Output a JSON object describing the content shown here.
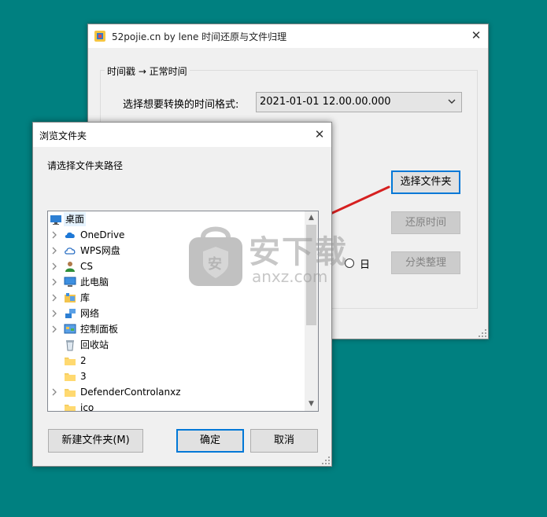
{
  "main_window": {
    "title": "52pojie.cn by lene 时间还原与文件归理",
    "close_glyph": "✕",
    "group_legend": "时间戳 → 正常时间",
    "format_label": "选择想要转换的时间格式:",
    "format_selected": "2021-01-01 12.00.00.000",
    "select_folder_button": "选择文件夹",
    "restore_time_button": "还原时间",
    "radio_day_label": "日",
    "classify_button": "分类整理"
  },
  "dialog": {
    "title": "浏览文件夹",
    "close_glyph": "✕",
    "prompt": "请选择文件夹路径",
    "tree_items": [
      {
        "label": "桌面",
        "icon": "desktop-icon",
        "expandable": false,
        "selected": true
      },
      {
        "label": "OneDrive",
        "icon": "cloud-icon",
        "expandable": true,
        "selected": false
      },
      {
        "label": "WPS网盘",
        "icon": "cloud-outline-icon",
        "expandable": true,
        "selected": false
      },
      {
        "label": "CS",
        "icon": "user-icon",
        "expandable": true,
        "selected": false
      },
      {
        "label": "此电脑",
        "icon": "computer-icon",
        "expandable": true,
        "selected": false
      },
      {
        "label": "库",
        "icon": "library-icon",
        "expandable": true,
        "selected": false
      },
      {
        "label": "网络",
        "icon": "network-icon",
        "expandable": true,
        "selected": false
      },
      {
        "label": "控制面板",
        "icon": "control-panel-icon",
        "expandable": true,
        "selected": false
      },
      {
        "label": "回收站",
        "icon": "recycle-bin-icon",
        "expandable": false,
        "selected": false
      },
      {
        "label": "2",
        "icon": "folder-icon",
        "expandable": false,
        "selected": false
      },
      {
        "label": "3",
        "icon": "folder-icon",
        "expandable": false,
        "selected": false
      },
      {
        "label": "DefenderControlanxz",
        "icon": "folder-icon",
        "expandable": true,
        "selected": false
      },
      {
        "label": "ico",
        "icon": "folder-icon",
        "expandable": false,
        "selected": false
      }
    ],
    "new_folder_button": "新建文件夹(M)",
    "ok_button": "确定",
    "cancel_button": "取消"
  },
  "watermark": {
    "logo_glyph": "安",
    "brand_cn": "安下载",
    "brand_domain": "anxz.com"
  },
  "colors": {
    "desktop": "#008080",
    "focus_border": "#0078d7",
    "annotation_arrow": "#d62020"
  }
}
